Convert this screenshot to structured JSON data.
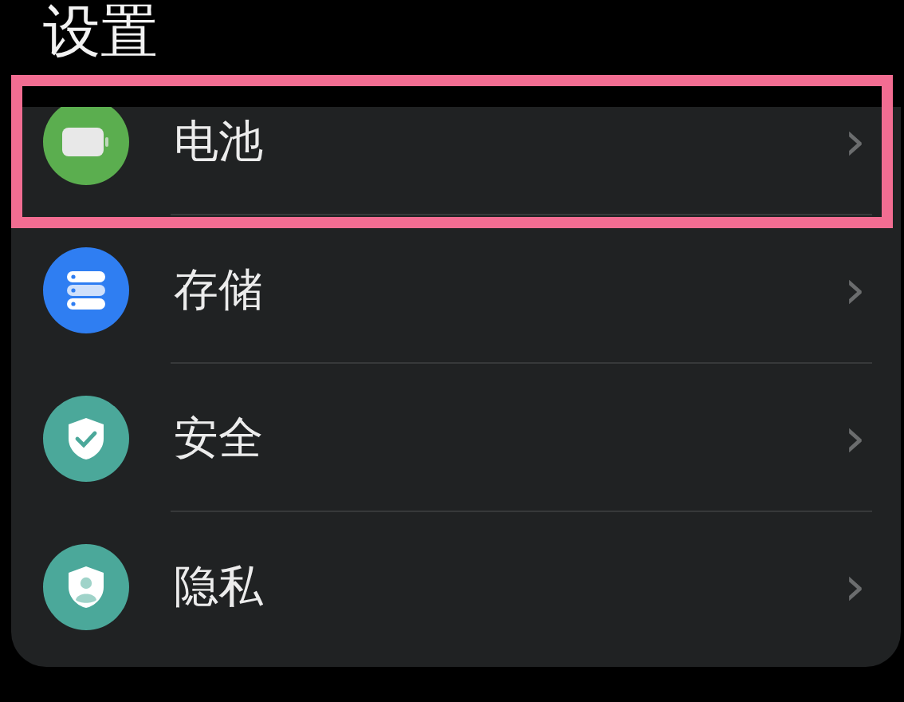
{
  "title": "设置",
  "items": [
    {
      "label": "电池",
      "color": "#5bae4f",
      "highlighted": true,
      "chevron": "›"
    },
    {
      "label": "存储",
      "color": "#2f7ef2",
      "highlighted": false,
      "chevron": "›"
    },
    {
      "label": "安全",
      "color": "#4ba89a",
      "highlighted": false,
      "chevron": "›"
    },
    {
      "label": "隐私",
      "color": "#4ba89a",
      "highlighted": false,
      "chevron": "›"
    }
  ]
}
